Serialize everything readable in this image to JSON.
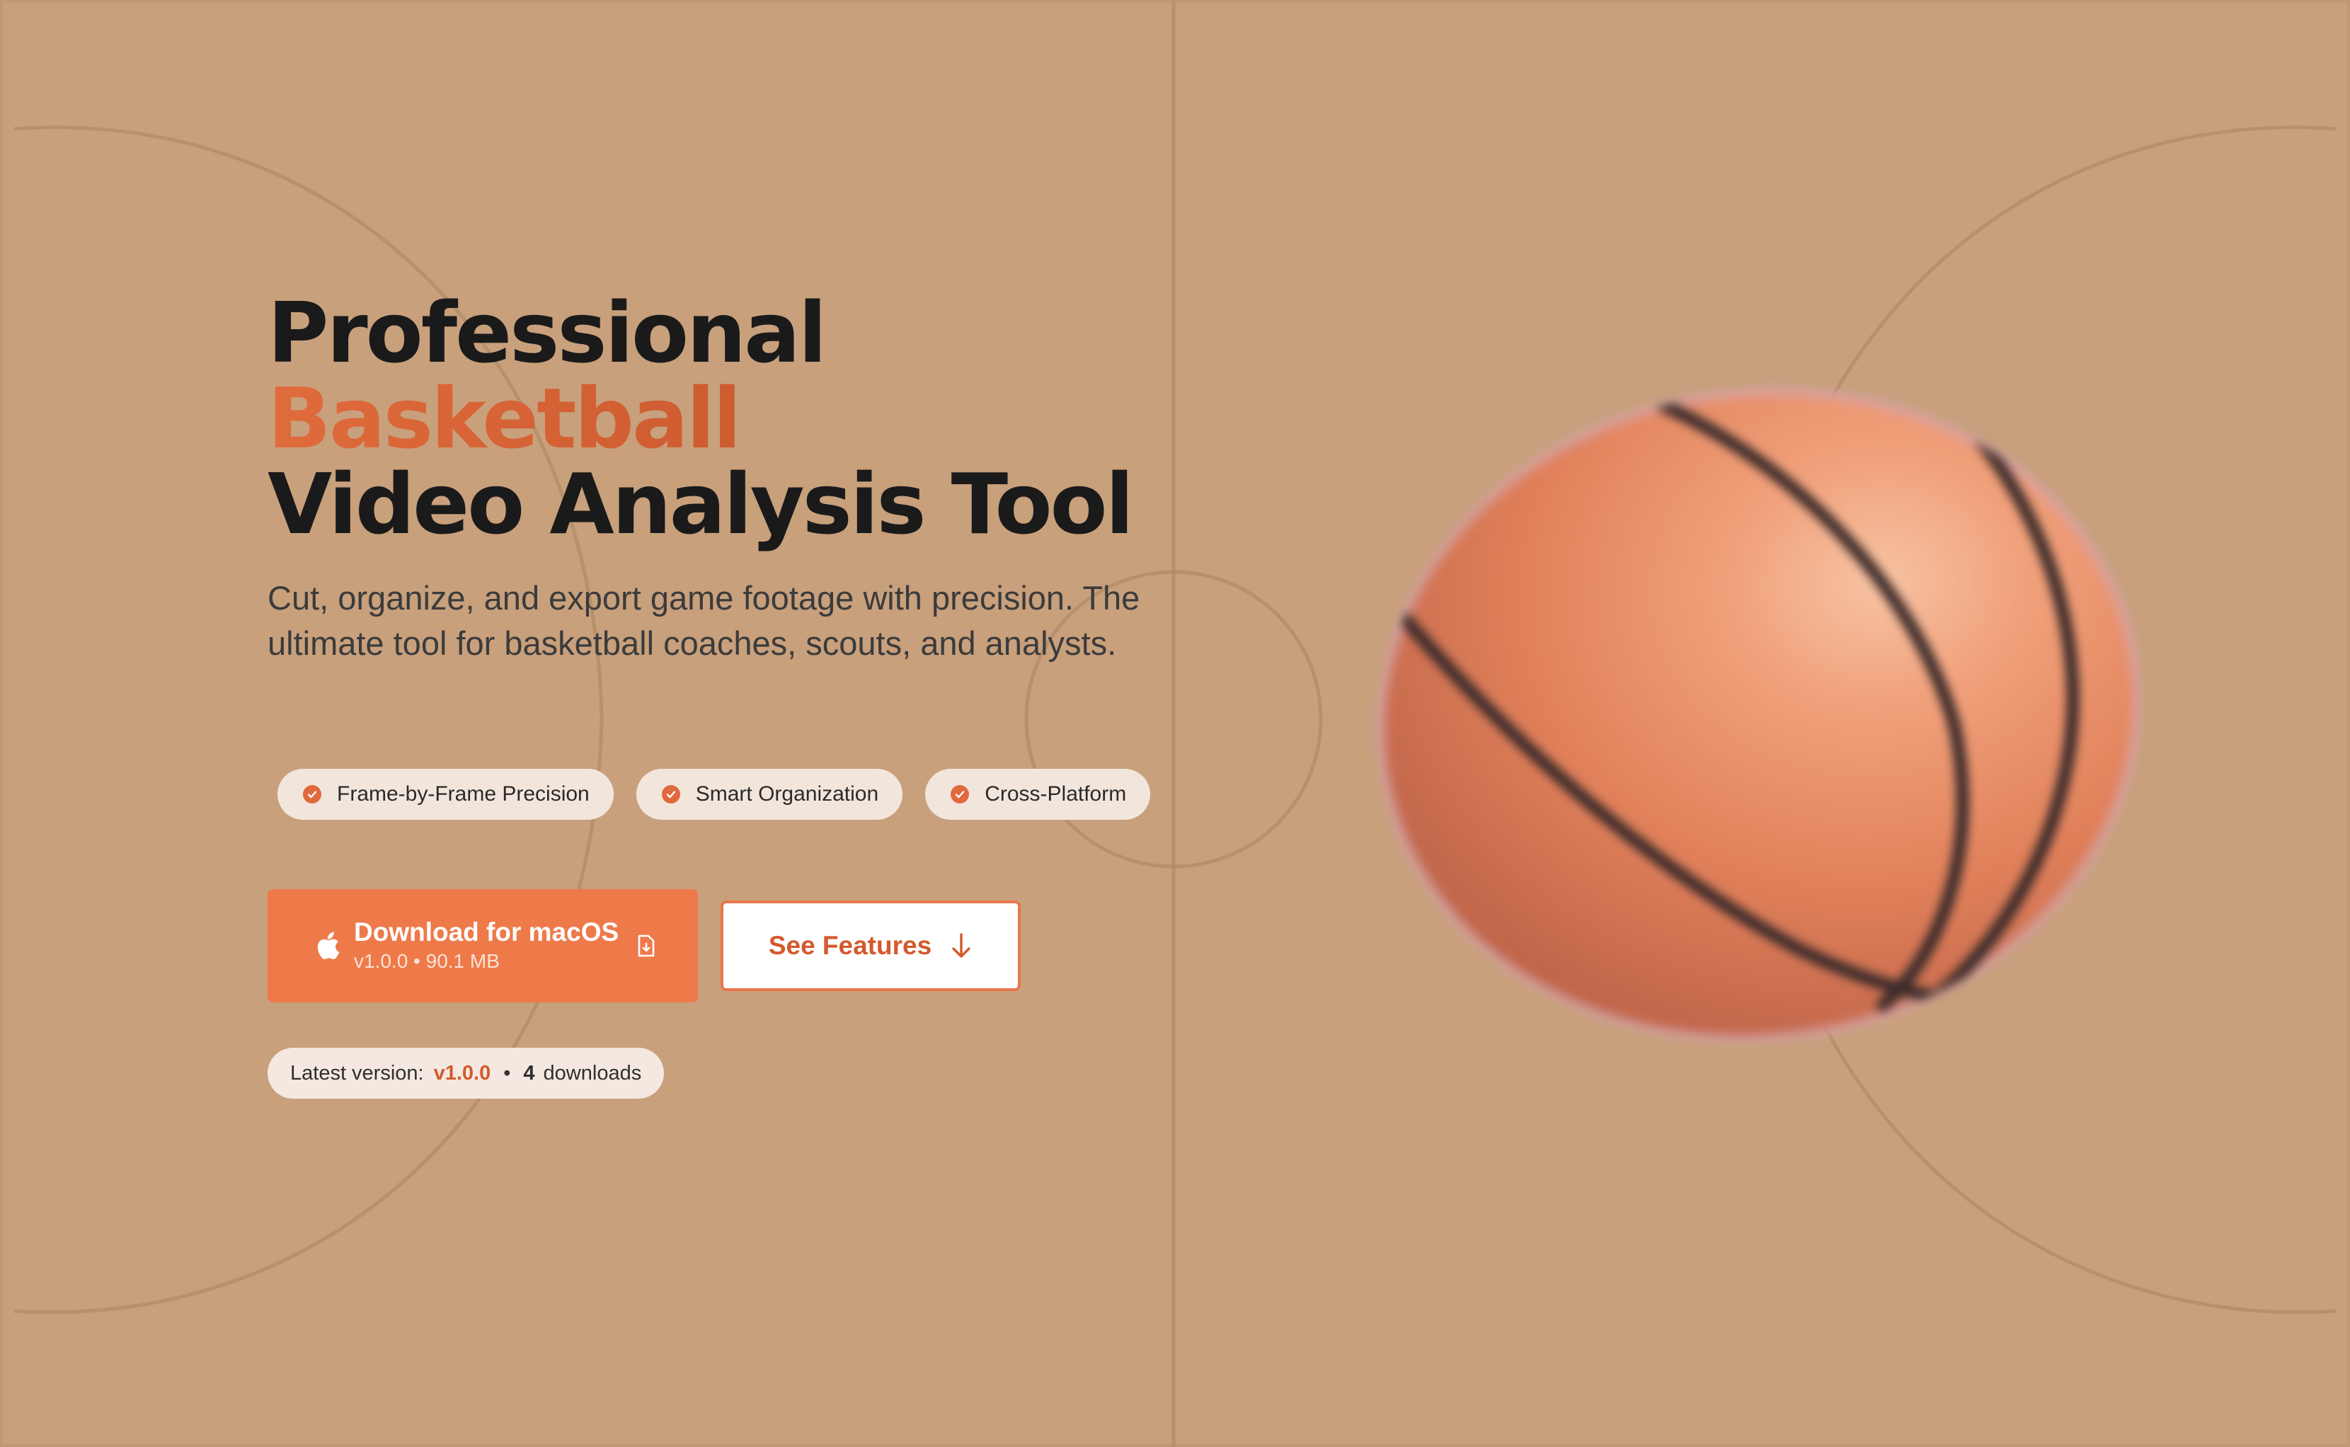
{
  "hero": {
    "headline_line1": "Professional",
    "headline_accent": "Basketball",
    "headline_line3": "Video Analysis Tool",
    "subtitle": "Cut, organize, and export game footage with precision. The ultimate tool for basketball coaches, scouts, and analysts."
  },
  "features": [
    {
      "label": "Frame-by-Frame Precision",
      "icon": "check-circle-icon"
    },
    {
      "label": "Smart Organization",
      "icon": "check-circle-icon"
    },
    {
      "label": "Cross-Platform",
      "icon": "check-circle-icon"
    }
  ],
  "download": {
    "label": "Download for macOS",
    "meta": "v1.0.0 • 90.1 MB",
    "platform_icon": "apple-icon",
    "file_icon": "file-download-icon"
  },
  "see_features": {
    "label": "See Features",
    "icon": "arrow-down-icon"
  },
  "release": {
    "prefix": "Latest version:",
    "version": "v1.0.0",
    "separator": "•",
    "download_count": "4",
    "downloads_label": "downloads"
  },
  "colors": {
    "background": "#c8a07c",
    "accent": "#ee7a4a",
    "accent_text": "#d35a2d",
    "headline": "#1a1a1a"
  }
}
